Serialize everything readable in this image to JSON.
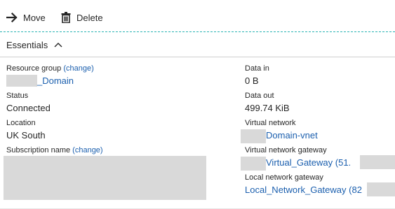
{
  "toolbar": {
    "move_label": "Move",
    "delete_label": "Delete"
  },
  "essentials": {
    "label": "Essentials"
  },
  "left": {
    "resource_group_label": "Resource group",
    "resource_group_change": "(change)",
    "resource_group_value": "_Domain",
    "status_label": "Status",
    "status_value": "Connected",
    "location_label": "Location",
    "location_value": "UK South",
    "subscription_label": "Subscription name",
    "subscription_change": "(change)"
  },
  "right": {
    "data_in_label": "Data in",
    "data_in_value": "0 B",
    "data_out_label": "Data out",
    "data_out_value": "499.74 KiB",
    "vnet_label": "Virtual network",
    "vnet_value": "Domain-vnet",
    "vnet_gateway_label": "Virtual network gateway",
    "vnet_gateway_value": "Virtual_Gateway (51.",
    "local_gateway_label": "Local network gateway",
    "local_gateway_value": "Local_Network_Gateway (82"
  },
  "colors": {
    "link": "#1b5fae",
    "accent_divider": "#2bb4b4",
    "redaction": "#d9d9d9"
  }
}
